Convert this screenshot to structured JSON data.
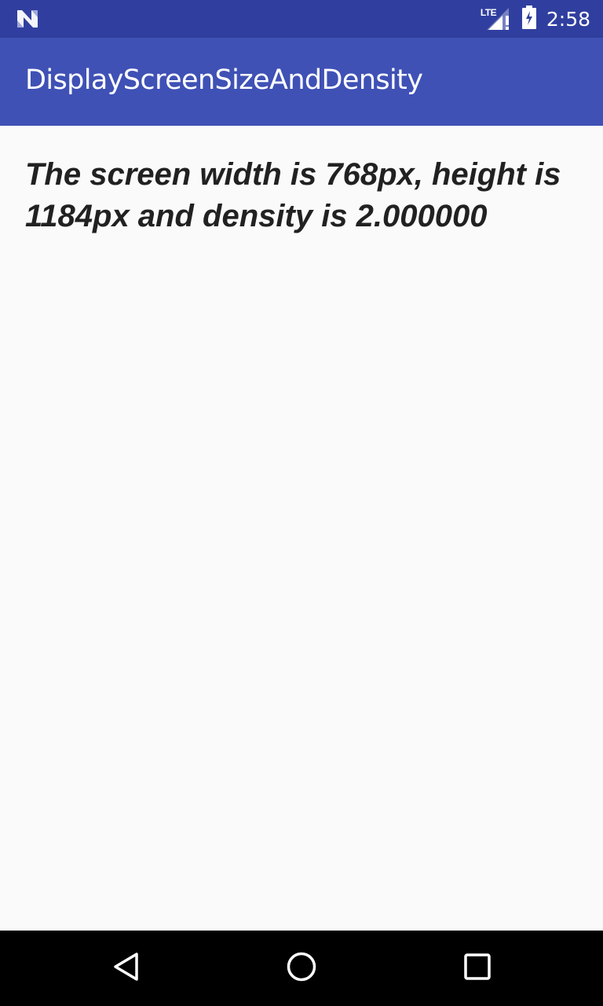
{
  "status_bar": {
    "notification_icon": "n-logo-icon",
    "network_label": "LTE",
    "time": "2:58"
  },
  "app_bar": {
    "title": "DisplayScreenSizeAndDensity"
  },
  "content": {
    "message": "The screen width is 768px, height is 1184px and density is 2.000000"
  },
  "nav_bar": {
    "back_icon": "back-triangle-icon",
    "home_icon": "home-circle-icon",
    "recents_icon": "recents-square-icon"
  },
  "colors": {
    "status_bar": "#303f9f",
    "app_bar": "#3f51b5",
    "background": "#fafafa",
    "text": "#212121",
    "nav_bar": "#000000"
  }
}
